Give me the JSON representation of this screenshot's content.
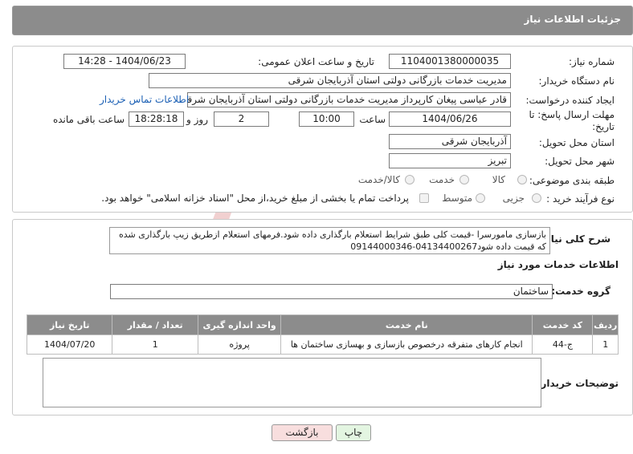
{
  "header": {
    "title": "جزئیات اطلاعات نیاز"
  },
  "fields": {
    "need_number_label": "شماره نیاز:",
    "need_number": "1104001380000035",
    "announce_label": "تاریخ و ساعت اعلان عمومی:",
    "announce_value": "1404/06/23 - 14:28",
    "buyer_org_label": "نام دستگاه خریدار:",
    "buyer_org": "مدیریت خدمات بازرگانی دولتی استان آذربایجان شرقی",
    "creator_label": "ایجاد کننده درخواست:",
    "creator": "قادر عباسی پیغان کارپرداز مدیریت خدمات بازرگانی دولتی استان آذربایجان شرقی",
    "contact_link": "اطلاعات تماس خریدار",
    "deadline_label": "مهلت ارسال پاسخ: تا تاریخ:",
    "deadline_date": "1404/06/26",
    "time_label": "ساعت",
    "deadline_time": "10:00",
    "days_value": "2",
    "days_label": "روز و",
    "remaining_time": "18:28:18",
    "remaining_label": "ساعت باقی مانده",
    "province_label": "استان محل تحویل:",
    "province": "آذربایجان شرقی",
    "city_label": "شهر محل تحویل:",
    "city": "تبریز",
    "category_label": "طبقه بندی موضوعی:",
    "category_options": [
      "کالا",
      "خدمت",
      "کالا/خدمت"
    ],
    "process_label": "نوع فرآیند خرید :",
    "process_options": [
      "جزیی",
      "متوسط"
    ],
    "payment_note": "پرداخت تمام یا بخشی از مبلغ خرید،از محل \"اسناد خزانه اسلامی\" خواهد بود."
  },
  "description": {
    "label": "شرح کلی نیاز:",
    "text": "بازسازی مامورسرا -قیمت کلی طبق شرایط استعلام بارگذاری داده شود.فرمهای استعلام ازطریق زیپ بارگذاری شده که قیمت داده شود04134400267-09144000346"
  },
  "services": {
    "section_title": "اطلاعات خدمات مورد نیاز",
    "group_label": "گروه خدمت:",
    "group_value": "ساختمان",
    "columns": [
      "ردیف",
      "کد خدمت",
      "نام خدمت",
      "واحد اندازه گیری",
      "تعداد / مقدار",
      "تاریخ نیاز"
    ],
    "rows": [
      [
        "1",
        "ج-44",
        "انجام کارهای متفرقه درخصوص بازسازی و بهسازی ساختمان ها",
        "پروژه",
        "1",
        "1404/07/20"
      ]
    ]
  },
  "buyer_notes": {
    "label": "توضیحات خریدار:"
  },
  "buttons": {
    "print": "چاپ",
    "back": "بازگشت"
  },
  "watermark": {
    "text": "AriaTender.neT"
  },
  "colors": {
    "header_bg": "#8c8c8c",
    "link": "#1a5fb4",
    "back_btn_bg": "#f8dede",
    "print_btn_bg": "#e3f5e1",
    "watermark": "#e7a6a6"
  }
}
